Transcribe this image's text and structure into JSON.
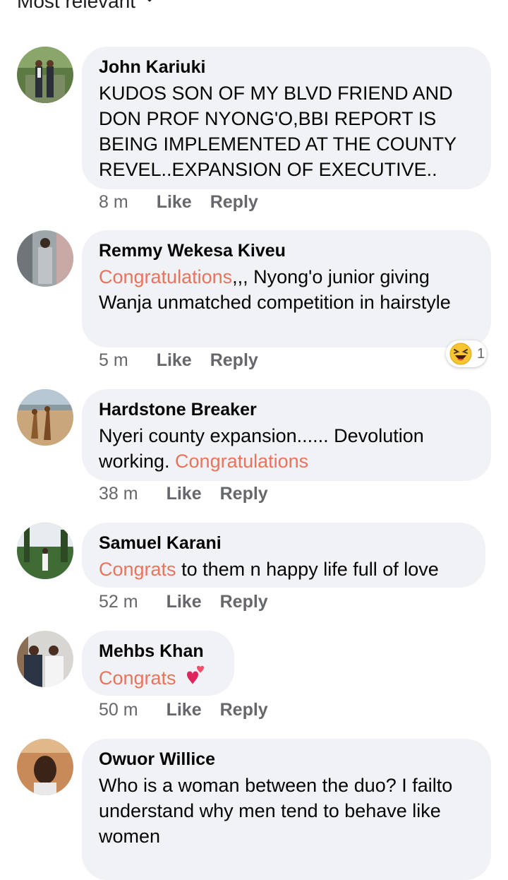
{
  "sort": {
    "label": "Most relevant"
  },
  "comments": [
    {
      "author": "John Kariuki",
      "text": "KUDOS SON OF MY BLVD FRIEND AND DON PROF NYONG'O,BBI REPORT IS BEING IMPLEMENTED AT THE COUNTY REVEL..EXPANSION OF EXECUTIVE..",
      "time": "8 m",
      "like": "Like",
      "reply": "Reply"
    },
    {
      "author": "Remmy Wekesa Kiveu",
      "highlight": "Congratulations",
      "text": ",,, Nyong'o junior giving Wanja unmatched competition in hairstyle",
      "time": "5 m",
      "like": "Like",
      "reply": "Reply",
      "reaction": {
        "icon": "laughing-emoji",
        "count": "1"
      }
    },
    {
      "author": "Hardstone Breaker",
      "text": "Nyeri county expansion...... Devolution working. ",
      "highlight": "Congratulations",
      "time": "38 m",
      "like": "Like",
      "reply": "Reply"
    },
    {
      "author": "Samuel Karani",
      "highlight": "Congrats",
      "text": " to them n happy life full of love",
      "time": "52 m",
      "like": "Like",
      "reply": "Reply"
    },
    {
      "author": "Mehbs Khan",
      "highlight": "Congrats",
      "emoji": "two-hearts",
      "time": "50 m",
      "like": "Like",
      "reply": "Reply"
    },
    {
      "author": "Owuor Willice",
      "text": "Who is a woman between the duo? I failto understand why men tend to behave like women"
    }
  ],
  "colors": {
    "bubble": "#f0f2f5",
    "highlight": "#e9735c",
    "meta": "#65676b"
  }
}
